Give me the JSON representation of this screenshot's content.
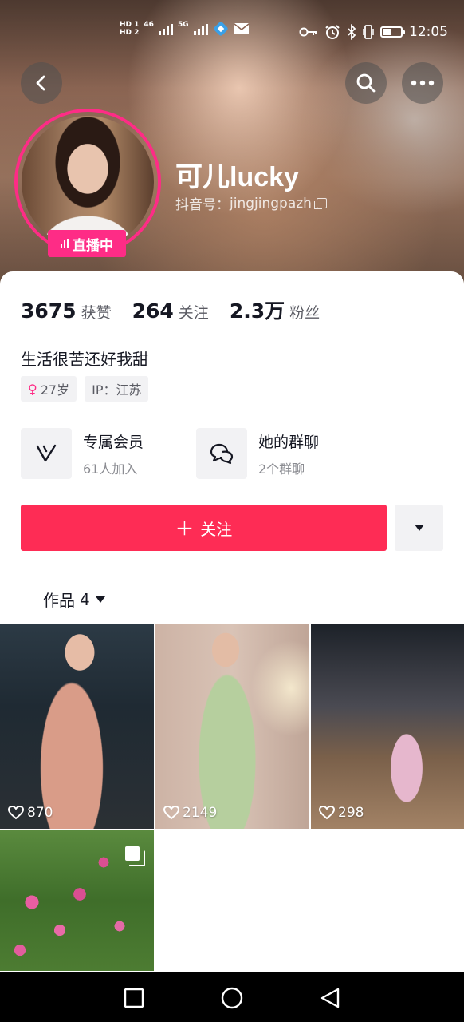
{
  "status_bar": {
    "time": "12:05",
    "hd1": "HD 1",
    "hd2": "HD 2",
    "net1": "46",
    "net2": "5G",
    "icons": [
      "signal-icon",
      "bluetooth-status-icon",
      "mail-icon",
      "key-icon",
      "alarm-icon",
      "bluetooth-icon",
      "vibrate-icon",
      "battery-icon"
    ]
  },
  "header": {
    "back_icon": "chevron-left-icon",
    "search_icon": "search-icon",
    "more_icon": "more-dots-icon"
  },
  "profile": {
    "nickname": "可儿lucky",
    "douyin_id_label": "抖音号：",
    "douyin_id": "jingjingpazh",
    "live_badge": "直播中",
    "stats": [
      {
        "value": "3675",
        "label": "获赞"
      },
      {
        "value": "264",
        "label": "关注"
      },
      {
        "value": "2.3万",
        "label": "粉丝"
      }
    ],
    "bio": "生活很苦还好我甜",
    "tags": {
      "age": "27岁",
      "ip": "IP：江苏"
    }
  },
  "features": [
    {
      "title": "专属会员",
      "subtitle": "61人加入",
      "icon": "vip-v-icon"
    },
    {
      "title": "她的群聊",
      "subtitle": "2个群聊",
      "icon": "group-chat-icon"
    }
  ],
  "actions": {
    "follow_label": "关注",
    "more_icon": "caret-down-icon"
  },
  "works_tab": {
    "label": "作品",
    "count": "4"
  },
  "works": [
    {
      "likes": "870"
    },
    {
      "likes": "2149"
    },
    {
      "likes": "298"
    },
    {
      "likes": ""
    }
  ],
  "colors": {
    "brand_pink": "#fe2c86",
    "follow_red": "#fe2c55",
    "text_primary": "#161823",
    "text_secondary": "#5a5b63"
  }
}
